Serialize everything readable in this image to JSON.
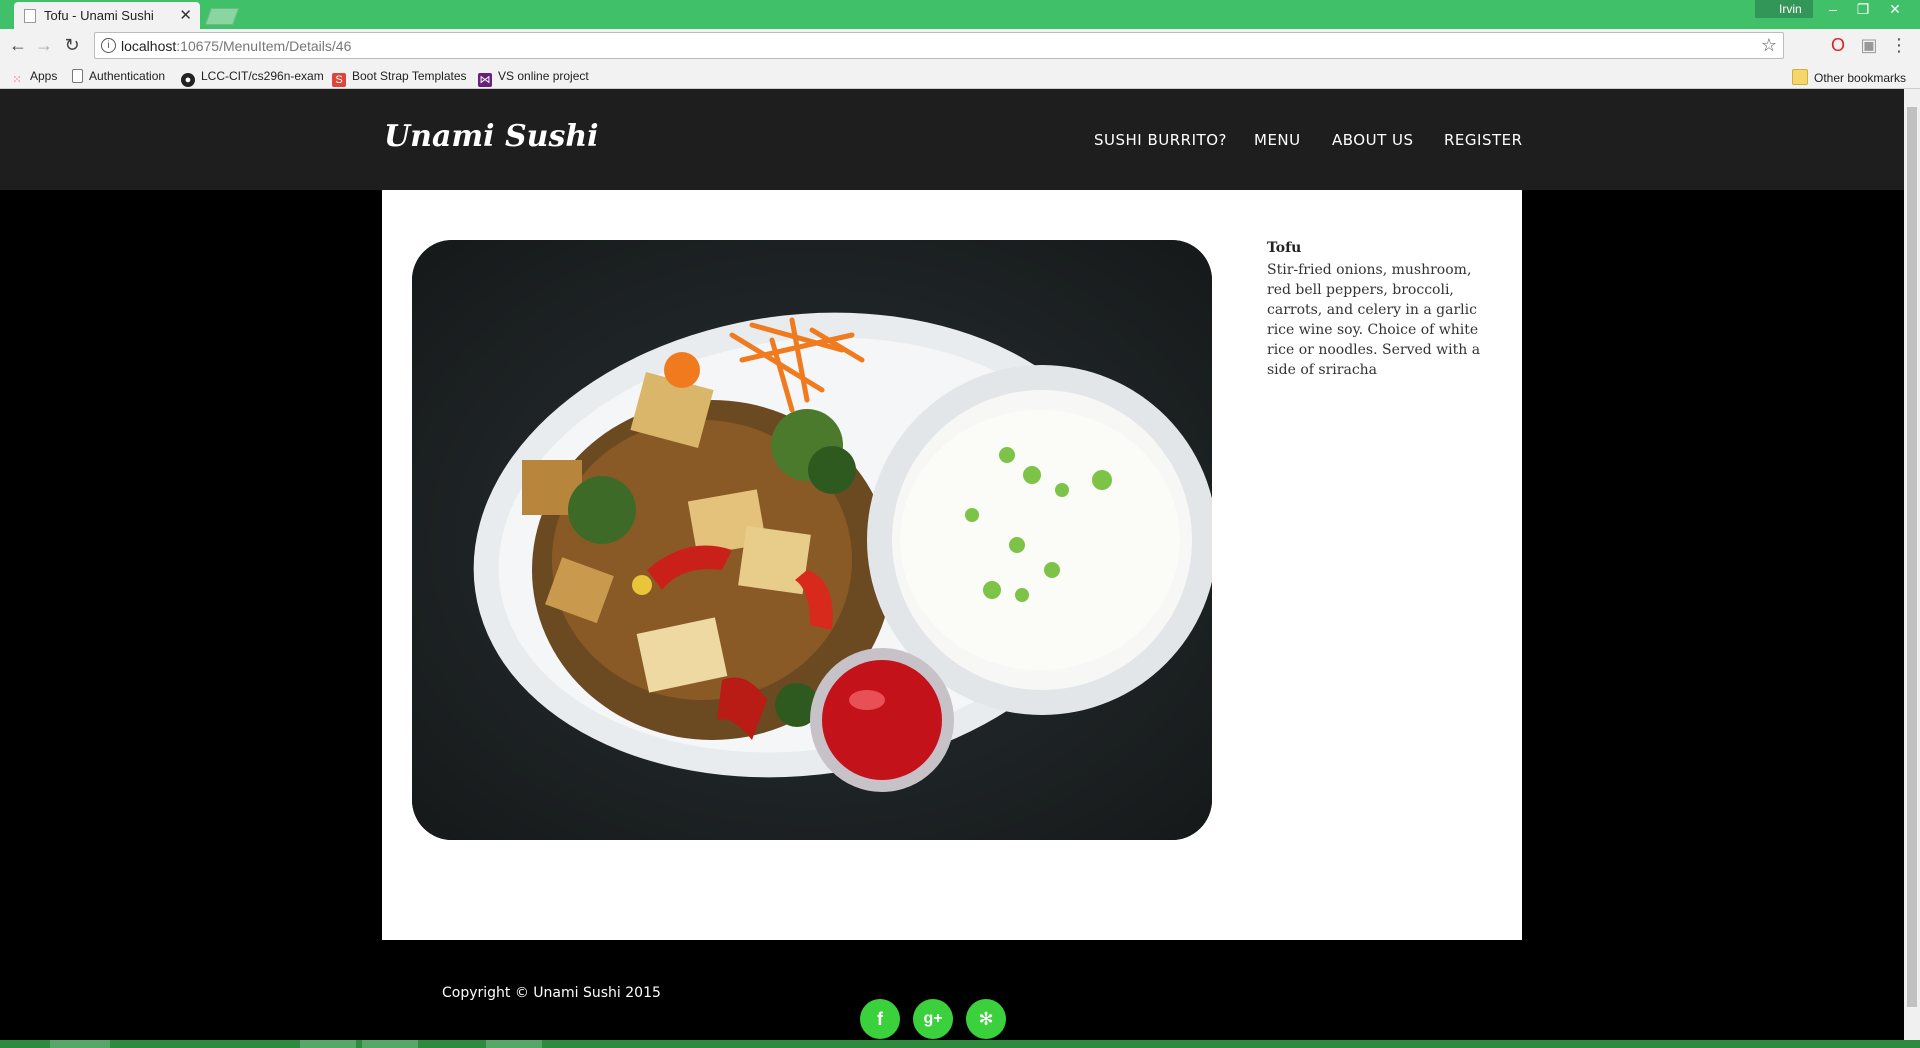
{
  "browser": {
    "tab_title": "Tofu - Unami Sushi",
    "tab_close": "✕",
    "profile_name": "Irvin",
    "url_host": "localhost",
    "url_rest": ":10675/MenuItem/Details/46",
    "bookmarks": [
      "Apps",
      "Authentication",
      "LCC-CIT/cs296n-exam",
      "Boot Strap Templates",
      "VS online project"
    ],
    "other_bookmarks": "Other bookmarks"
  },
  "site": {
    "brand": "Unami Sushi",
    "nav": [
      "SUSHI BURRITO?",
      "MENU",
      "ABOUT US",
      "REGISTER"
    ]
  },
  "item": {
    "name": "Tofu",
    "description": "Stir-fried onions, mushroom, red bell peppers, broccoli, carrots, and celery in a garlic rice wine soy. Choice of white rice or noodles. Served with a side of sriracha"
  },
  "footer": {
    "copyright": "Copyright © Unami Sushi 2015",
    "social": [
      {
        "name": "facebook-icon",
        "glyph": "f"
      },
      {
        "name": "google-plus-icon",
        "glyph": "g+"
      },
      {
        "name": "yelp-icon",
        "glyph": "✻"
      }
    ]
  },
  "colors": {
    "chrome_frame": "#3fc069",
    "site_nav": "#1e1e1e",
    "social_green": "#3ad13d"
  }
}
